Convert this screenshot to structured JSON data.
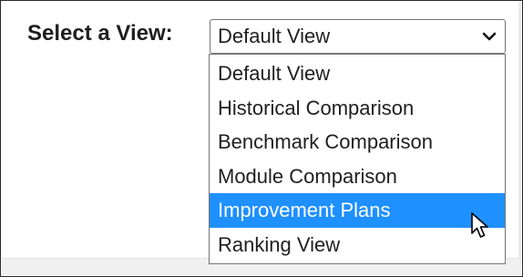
{
  "view_selector": {
    "label": "Select a View:",
    "selected_value": "Default View",
    "chevron_icon": "chevron-down-icon",
    "options": [
      {
        "label": "Default View",
        "highlighted": false
      },
      {
        "label": "Historical Comparison",
        "highlighted": false
      },
      {
        "label": "Benchmark Comparison",
        "highlighted": false
      },
      {
        "label": "Module Comparison",
        "highlighted": false
      },
      {
        "label": "Improvement Plans",
        "highlighted": true
      },
      {
        "label": "Ranking View",
        "highlighted": false
      }
    ]
  },
  "cursor": {
    "icon": "mouse-pointer-icon"
  },
  "colors": {
    "highlight_background": "#1e90ff",
    "highlight_text": "#ffffff",
    "text": "#1f1f1f",
    "border": "#767676"
  }
}
